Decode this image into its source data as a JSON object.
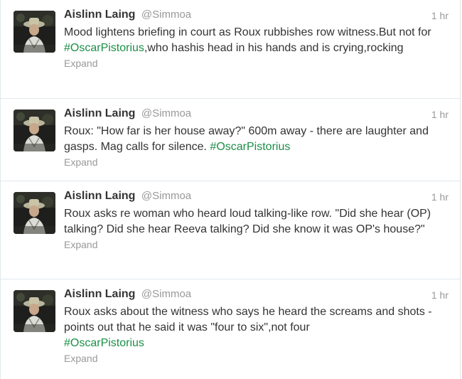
{
  "tweets": [
    {
      "fullname": "Aislinn Laing",
      "username": "@Simmoa",
      "time": "1 hr",
      "text_before": "Mood lightens briefing in court as Roux rubbishes row witness.But not for ",
      "hashtag": "#OscarPistorius",
      "text_after": ",who hashis head in his hands and is crying,rocking",
      "expand": "Expand"
    },
    {
      "fullname": "Aislinn Laing",
      "username": "@Simmoa",
      "time": "1 hr",
      "text_before": "Roux: \"How far is her house away?\" 600m away - there are laughter and gasps. Mag calls for silence. ",
      "hashtag": "#OscarPistorius",
      "text_after": "",
      "expand": "Expand"
    },
    {
      "fullname": "Aislinn Laing",
      "username": "@Simmoa",
      "time": "1 hr",
      "text_before": "Roux asks re woman who heard loud talking-like row. \"Did she hear (OP) talking? Did she hear Reeva talking? Did she know it was OP's house?\"",
      "hashtag": "",
      "text_after": "",
      "expand": "Expand"
    },
    {
      "fullname": "Aislinn Laing",
      "username": "@Simmoa",
      "time": "1 hr",
      "text_before": "Roux asks about the witness who says he heard the screams and shots - points out that he said it was \"four to six\",not four ",
      "hashtag": "#OscarPistorius",
      "text_after": "",
      "expand": "Expand"
    }
  ],
  "colors": {
    "hashtag": "#1b8f47",
    "meta": "#999999",
    "text": "#333333",
    "divider": "#e1e8ed"
  },
  "icons": {
    "avatar": "user-avatar-photo"
  }
}
